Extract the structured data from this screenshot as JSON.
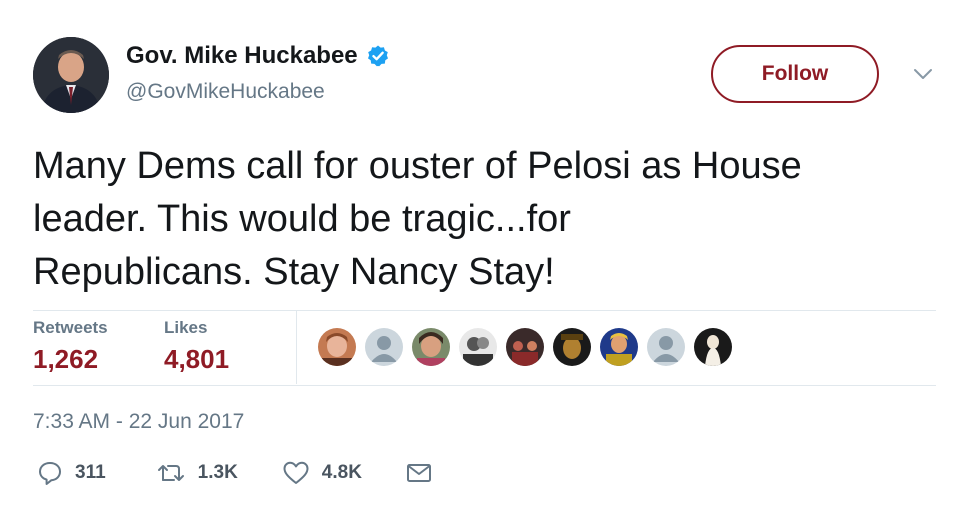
{
  "author": {
    "name": "Gov. Mike Huckabee",
    "handle": "@GovMikeHuckabee"
  },
  "header": {
    "follow_label": "Follow"
  },
  "tweet": {
    "text": "Many Dems call for ouster of Pelosi as House\nleader.  This would be tragic...for\nRepublicans.  Stay Nancy Stay!",
    "timestamp": "7:33 AM - 22 Jun 2017"
  },
  "stats": {
    "retweets_label": "Retweets",
    "retweets_value": "1,262",
    "likes_label": "Likes",
    "likes_value": "4,801"
  },
  "actions": {
    "reply_count": "311",
    "retweet_count": "1.3K",
    "like_count": "4.8K"
  },
  "icons": [
    "verified-badge-icon",
    "chevron-down-icon",
    "reply-icon",
    "retweet-icon",
    "heart-icon",
    "envelope-icon"
  ],
  "colors": {
    "accent": "#8f1b25",
    "verified": "#1da1f2",
    "secondary_text": "#657786",
    "divider": "#e1e8ed"
  }
}
